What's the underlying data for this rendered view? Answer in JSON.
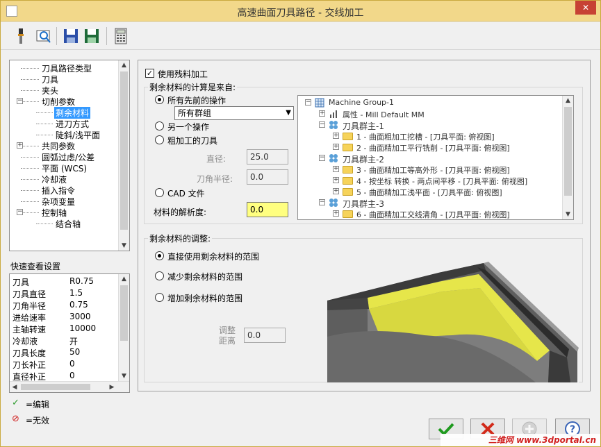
{
  "window": {
    "title": "高速曲面刀具路径 - 交线加工",
    "close_glyph": "✕"
  },
  "toolbar": {
    "buttons": [
      {
        "name": "tool-icon"
      },
      {
        "name": "preview-icon"
      },
      {
        "name": "save-icon"
      },
      {
        "name": "save-as-icon"
      },
      {
        "name": "calculator-icon"
      }
    ]
  },
  "nav_tree": {
    "items": [
      {
        "label": "刀具路径类型",
        "indent": 1
      },
      {
        "label": "刀具",
        "indent": 1
      },
      {
        "label": "夹头",
        "indent": 1
      },
      {
        "label": "切削参数",
        "indent": 1,
        "toggle": "−"
      },
      {
        "label": "剩余材料",
        "indent": 2,
        "selected": true
      },
      {
        "label": "进刀方式",
        "indent": 2
      },
      {
        "label": "陡斜/浅平面",
        "indent": 2
      },
      {
        "label": "共同参数",
        "indent": 1,
        "toggle": "+"
      },
      {
        "label": "圆弧过虑/公差",
        "indent": 1
      },
      {
        "label": "平面 (WCS)",
        "indent": 1
      },
      {
        "label": "冷却液",
        "indent": 1
      },
      {
        "label": "插入指令",
        "indent": 1
      },
      {
        "label": "杂项变量",
        "indent": 1
      },
      {
        "label": "控制轴",
        "indent": 1,
        "toggle": "−"
      },
      {
        "label": "结合轴",
        "indent": 2
      }
    ]
  },
  "quick_view": {
    "title": "快速查看设置",
    "rows": [
      {
        "key": "刀具",
        "value": "R0.75"
      },
      {
        "key": "刀具直径",
        "value": "1.5"
      },
      {
        "key": "刀角半径",
        "value": "0.75"
      },
      {
        "key": "进给速率",
        "value": "3000"
      },
      {
        "key": "主轴转速",
        "value": "10000"
      },
      {
        "key": "冷却液",
        "value": "开"
      },
      {
        "key": "刀具长度",
        "value": "50"
      },
      {
        "key": "刀长补正",
        "value": "0"
      },
      {
        "key": "直径补正",
        "value": "0"
      }
    ]
  },
  "legend_items": [
    {
      "symbol": "✓",
      "label": "=编辑",
      "color": "#2a9a2a"
    },
    {
      "symbol": "⊘",
      "label": "=无效",
      "color": "#d02020"
    }
  ],
  "rest_material": {
    "use_checkbox_label": "使用残料加工",
    "source_group_label": "剩余材料的计算是来自:",
    "options": {
      "all_previous": "所有先前的操作",
      "another_op": "另一个操作",
      "roughing_tool": "粗加工的刀具",
      "cad_file": "CAD 文件"
    },
    "group_select_value": "所有群组",
    "diameter_label": "直径:",
    "diameter_value": "25.0",
    "corner_radius_label": "刀角半径:",
    "corner_radius_value": "0.0",
    "resolution_label": "材料的解析度:",
    "resolution_value": "0.0"
  },
  "ops_tree": {
    "rows": [
      {
        "text": "Machine Group-1",
        "level": 0,
        "pm": "−",
        "icon": "machine"
      },
      {
        "text": "属性 - Mill Default MM",
        "level": 1,
        "pm": "+",
        "icon": "props"
      },
      {
        "text": "刀具群主-1",
        "level": 1,
        "pm": "−",
        "icon": "group"
      },
      {
        "text": "1 - 曲面粗加工挖槽 - [刀具平面: 俯视图]",
        "level": 2,
        "pm": "+",
        "icon": "folder"
      },
      {
        "text": "2 - 曲面精加工平行铣削 - [刀具平面: 俯视图]",
        "level": 2,
        "pm": "+",
        "icon": "folder"
      },
      {
        "text": "刀具群主-2",
        "level": 1,
        "pm": "−",
        "icon": "group"
      },
      {
        "text": "3 - 曲面精加工等高外形 - [刀具平面: 俯视图]",
        "level": 2,
        "pm": "+",
        "icon": "folder"
      },
      {
        "text": "4 - 按坐标 转换 - 两点间平移 - [刀具平面: 俯视图]",
        "level": 2,
        "pm": "+",
        "icon": "folder"
      },
      {
        "text": "5 - 曲面精加工浅平面 - [刀具平面: 俯视图]",
        "level": 2,
        "pm": "+",
        "icon": "folder"
      },
      {
        "text": "刀具群主-3",
        "level": 1,
        "pm": "−",
        "icon": "group"
      },
      {
        "text": "6 - 曲面精加工交线清角 - [刀具平面: 俯视图]",
        "level": 2,
        "pm": "+",
        "icon": "folder"
      }
    ]
  },
  "adjustment": {
    "group_label": "剩余材料的调整:",
    "options": {
      "direct": "直接使用剩余材料的范围",
      "reduce": "减少剩余材料的范围",
      "increase": "增加剩余材料的范围"
    },
    "distance_label_line1": "调整",
    "distance_label_line2": "距离",
    "distance_value": "0.0"
  },
  "watermark": "三维网 www.3dportal.cn",
  "colors": {
    "titlebar": "#f2d88a",
    "highlight": "#ffff80",
    "selection": "#3399ff"
  }
}
